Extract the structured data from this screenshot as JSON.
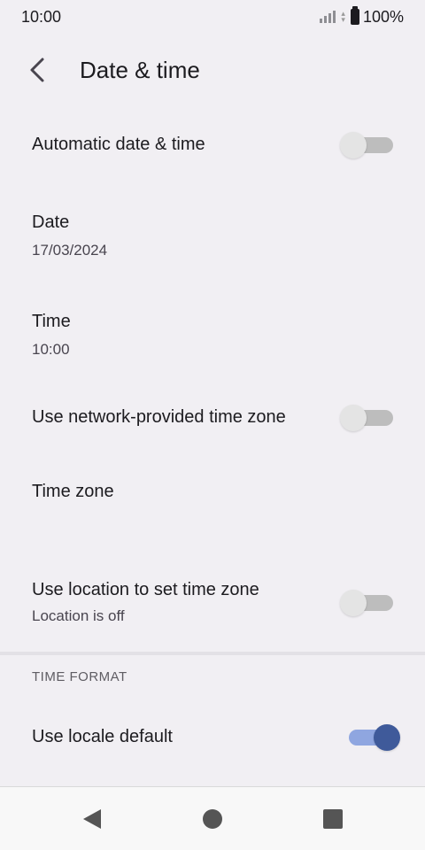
{
  "status_bar": {
    "time": "10:00",
    "battery": "100%"
  },
  "header": {
    "title": "Date & time"
  },
  "settings": {
    "auto_date_time": {
      "title": "Automatic date & time",
      "enabled": false
    },
    "date": {
      "title": "Date",
      "value": "17/03/2024"
    },
    "time": {
      "title": "Time",
      "value": "10:00"
    },
    "network_time_zone": {
      "title": "Use network-provided time zone",
      "enabled": false
    },
    "time_zone": {
      "title": "Time zone"
    },
    "location_time_zone": {
      "title": "Use location to set time zone",
      "summary": "Location is off",
      "enabled": false
    }
  },
  "time_format": {
    "header": "TIME FORMAT",
    "locale_default": {
      "title": "Use locale default",
      "enabled": true
    }
  },
  "colors": {
    "accent": "#3f5a9a",
    "accent_track": "#8fa6e0",
    "background": "#f1eff3"
  }
}
